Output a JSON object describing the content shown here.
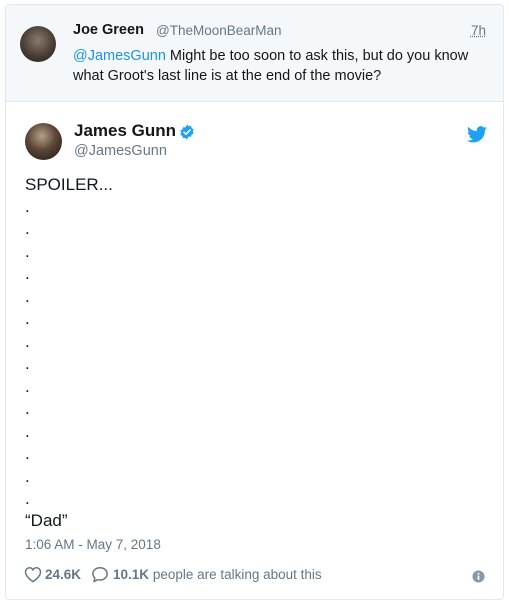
{
  "parent_tweet": {
    "name": "Joe Green",
    "handle": "@TheMoonBearMan",
    "time": "7h",
    "mention": "@JamesGunn",
    "text": " Might be too soon to ask this, but do you know what Groot's last line is at the end of the movie?"
  },
  "main_tweet": {
    "name": "James Gunn",
    "handle": "@JamesGunn",
    "lines": [
      "SPOILER...",
      ".",
      ".",
      ".",
      ".",
      ".",
      ".",
      ".",
      ".",
      ".",
      ".",
      ".",
      ".",
      ".",
      ".",
      "“Dad”"
    ],
    "timestamp": "1:06 AM - May 7, 2018",
    "likes": "24.6K",
    "talking_count": "10.1K",
    "talking_text": " people are talking about this"
  },
  "icons": {
    "verified": "verified-badge-icon",
    "bird": "twitter-bird-icon",
    "like": "heart-icon",
    "reply": "speech-bubble-icon",
    "info": "info-icon"
  },
  "colors": {
    "accent": "#1da1f2",
    "link": "#1b95e0",
    "muted": "#657786",
    "parent_bg": "#f5f8fa"
  }
}
